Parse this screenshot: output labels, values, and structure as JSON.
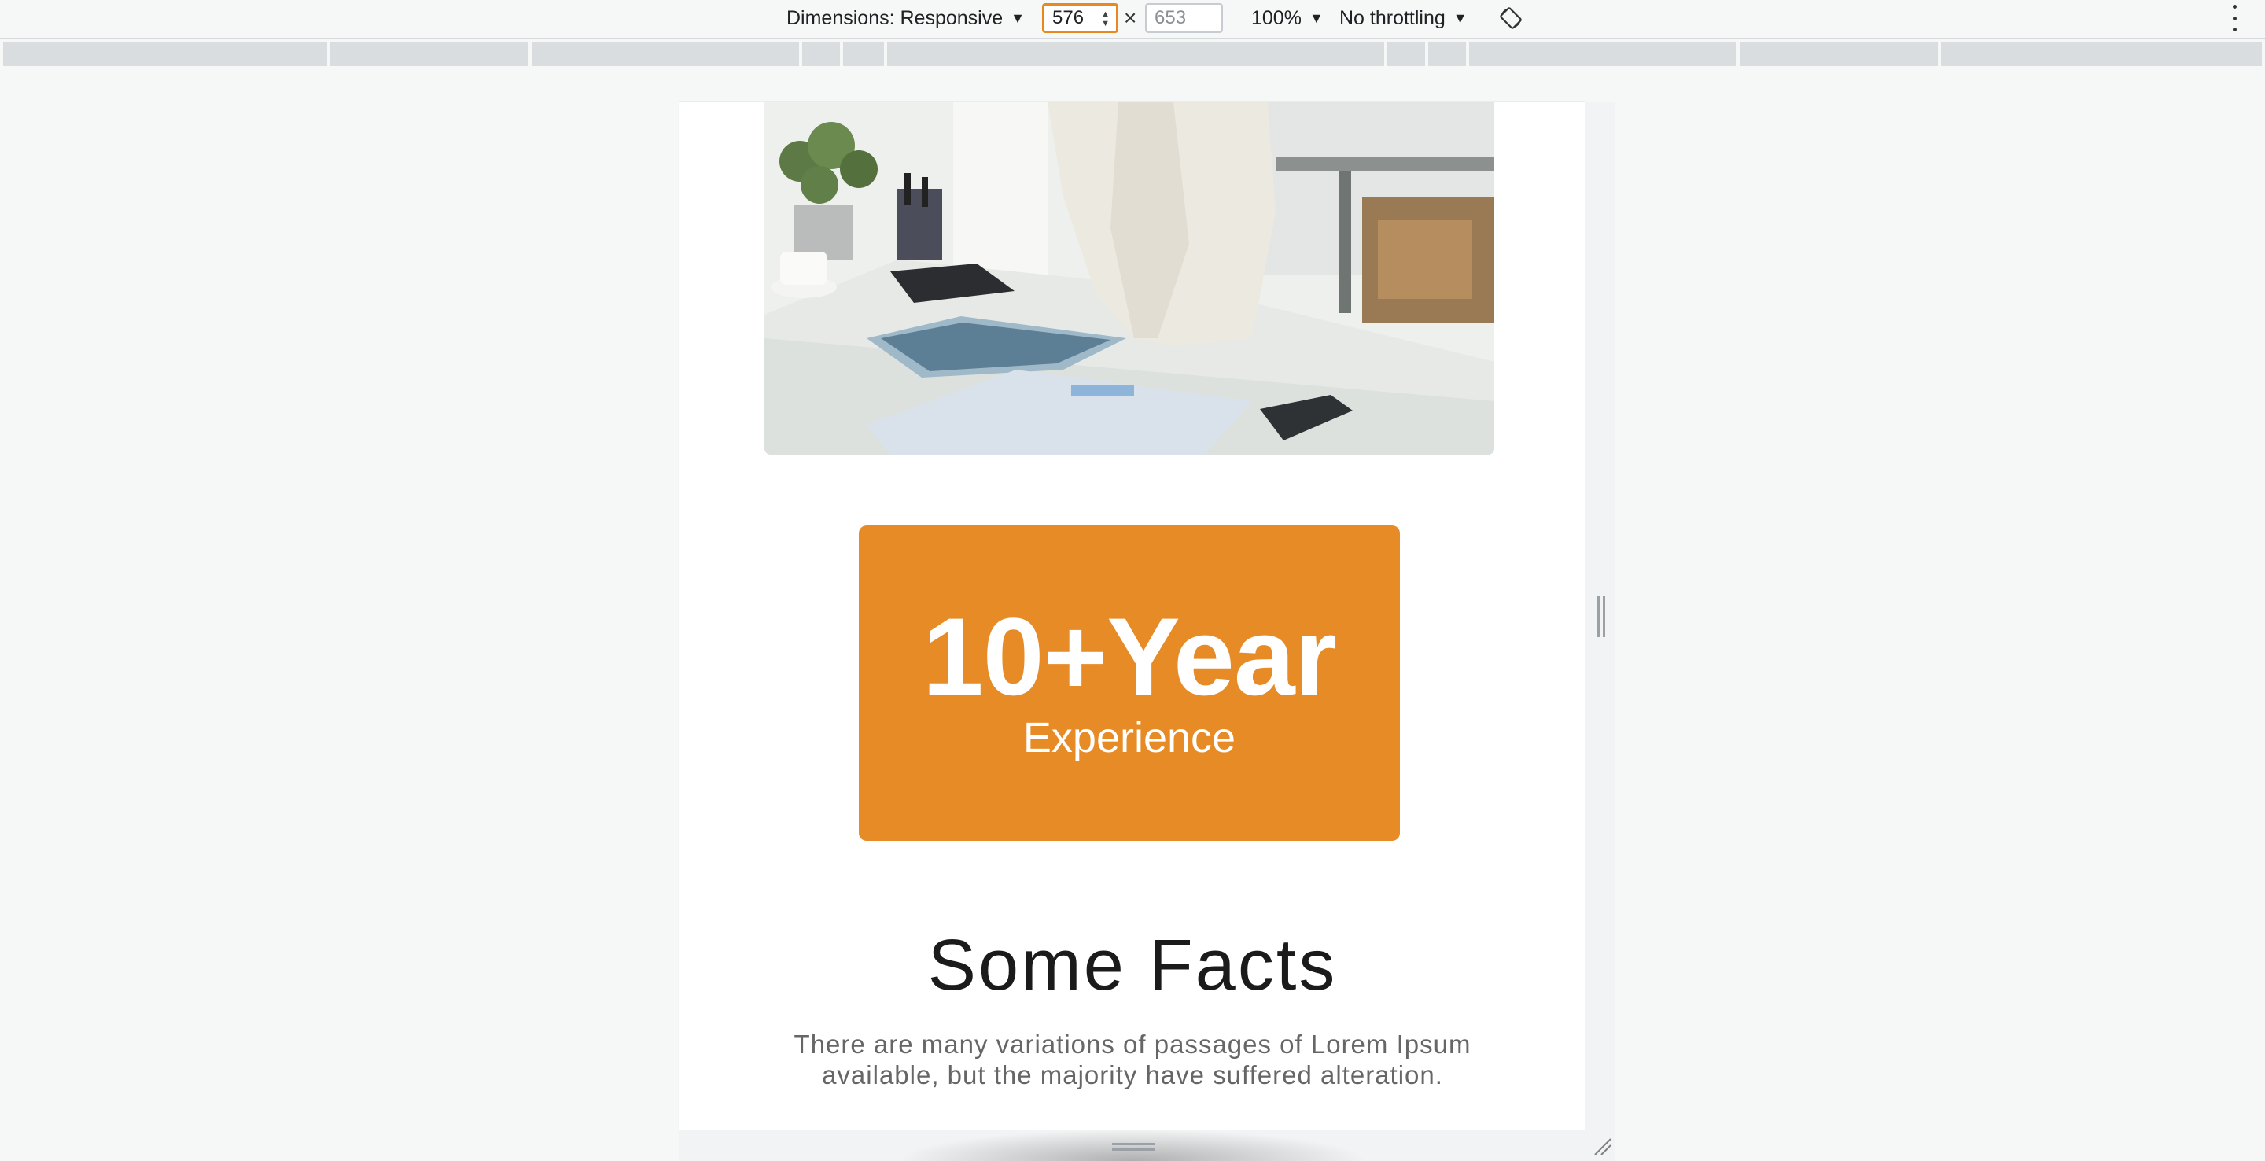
{
  "devtools": {
    "dimensions_label": "Dimensions: Responsive",
    "width_value": "576",
    "height_placeholder": "653",
    "times_symbol": "×",
    "zoom_label": "100%",
    "throttling_label": "No throttling",
    "caret": "▼",
    "icons": [
      "chevron-down-icon",
      "spinner-icon",
      "rotate-icon",
      "more-options-icon",
      "resize-handle-icon"
    ]
  },
  "page": {
    "hero_image": {
      "description_icon": "office-desk-photo"
    },
    "experience": {
      "number": "10+Year",
      "label": "Experience",
      "background_color": "#e68b26"
    },
    "facts": {
      "title": "Some Facts",
      "text_line1": "There are many variations of passages of Lorem Ipsum",
      "text_line2": "available, but the majority have suffered alteration."
    }
  }
}
